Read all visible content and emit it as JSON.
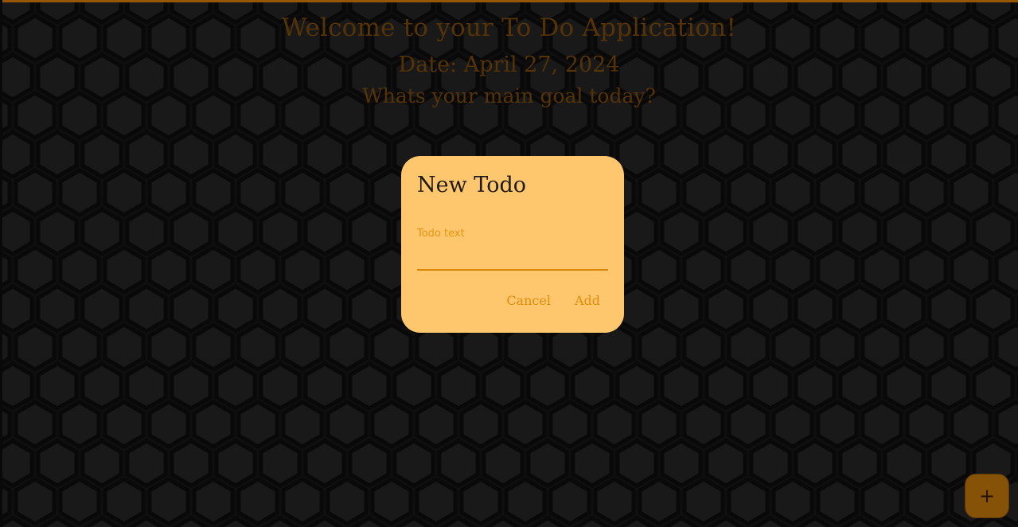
{
  "header": {
    "title": "Welcome to your To Do Application!",
    "date": "Date: April 27, 2024",
    "goal": "Whats your main goal today?"
  },
  "dialog": {
    "title": "New Todo",
    "field_label": "Todo text",
    "field_value": "",
    "cancel_label": "Cancel",
    "add_label": "Add"
  },
  "fab": {
    "icon": "plus-icon",
    "glyph": "+"
  },
  "colors": {
    "accent": "#b86a05",
    "dialog_bg": "#fec66d",
    "header_text": "#6a3f08",
    "button_text": "#e08d0b",
    "fab_bg": "#865208"
  }
}
